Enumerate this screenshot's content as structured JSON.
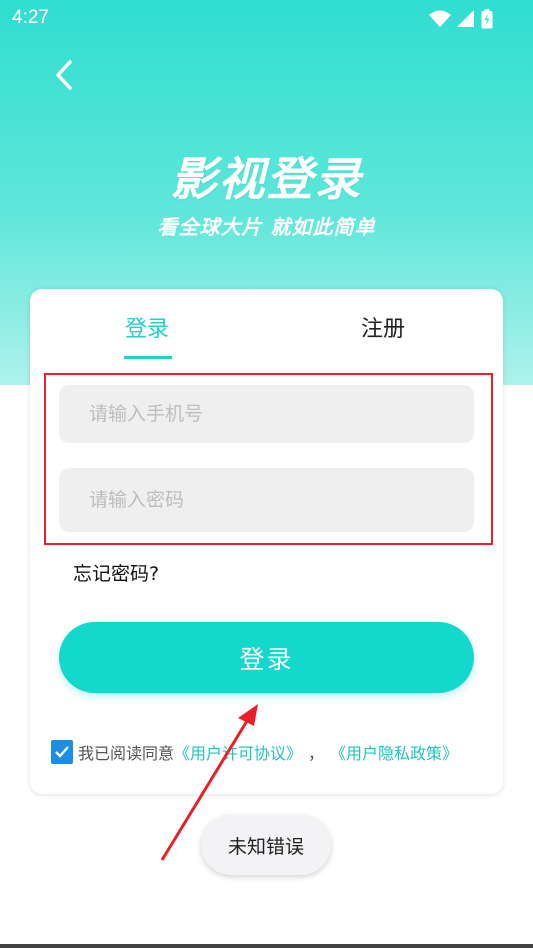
{
  "status_bar": {
    "time": "4:27",
    "icons": [
      "wifi-icon",
      "signal-icon",
      "battery-charging-icon"
    ]
  },
  "header": {
    "back_icon": "chevron-left-icon",
    "title": "影视登录",
    "subtitle": "看全球大片 就如此简单"
  },
  "tabs": [
    {
      "label": "登录",
      "active": true
    },
    {
      "label": "注册",
      "active": false
    }
  ],
  "form": {
    "phone_placeholder": "请输入手机号",
    "phone_value": "",
    "password_placeholder": "请输入密码",
    "password_value": "",
    "forgot_label": "忘记密码?",
    "login_button": "登录"
  },
  "agreement": {
    "checked": true,
    "text": "我已阅读同意",
    "user_agreement": "《用户许可协议》",
    "separator": "，",
    "privacy_policy": "《用户隐私政策》"
  },
  "toast": {
    "message": "未知错误"
  },
  "colors": {
    "accent": "#12d9cc",
    "header_gradient_top": "#2fded0",
    "annotation_red": "#e8202a",
    "checkbox_blue": "#1a8fe3"
  }
}
